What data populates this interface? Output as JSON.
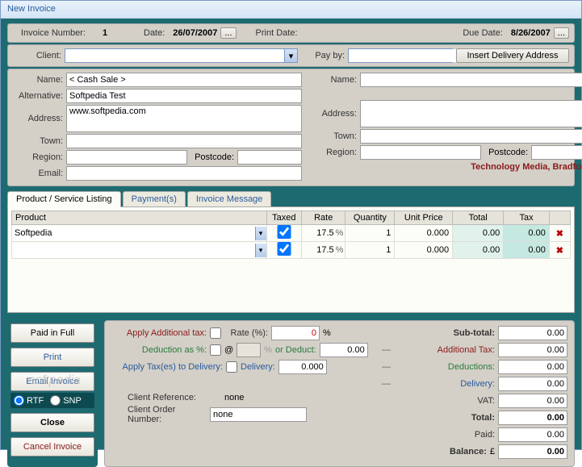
{
  "window": {
    "title": "New Invoice"
  },
  "topbar": {
    "invoice_number_label": "Invoice Number:",
    "invoice_number": "1",
    "date_label": "Date:",
    "date": "26/07/2007",
    "print_date_label": "Print Date:",
    "due_date_label": "Due Date:",
    "due_date": "8/26/2007"
  },
  "clientbar": {
    "client_label": "Client:",
    "payby_label": "Pay by:",
    "insert_addr_label": "Insert Delivery Address"
  },
  "fields": {
    "name_label": "Name:",
    "name": "< Cash Sale >",
    "alt_label": "Alternative:",
    "alt": "Softpedia Test",
    "addr_label": "Address:",
    "addr": "www.softpedia.com",
    "town_label": "Town:",
    "town": "",
    "region_label": "Region:",
    "region": "",
    "postcode_label": "Postcode:",
    "postcode": "",
    "email_label": "Email:",
    "email": "",
    "name2": "",
    "addr2": "",
    "town2": "",
    "region2": "",
    "postcode2": ""
  },
  "company_note": "Technology Media, Bradford.",
  "tabs": {
    "t1": "Product / Service Listing",
    "t2": "Payment(s)",
    "t3": "Invoice Message"
  },
  "gridhead": {
    "product": "Product",
    "taxed": "Taxed",
    "rate": "Rate",
    "qty": "Quantity",
    "unitprice": "Unit Price",
    "total": "Total",
    "tax": "Tax"
  },
  "rows": [
    {
      "product": "Softpedia",
      "taxed": true,
      "rate": "17.5",
      "qty": "1",
      "unitprice": "0.000",
      "total": "0.00",
      "tax": "0.00"
    },
    {
      "product": "",
      "taxed": true,
      "rate": "17.5",
      "qty": "1",
      "unitprice": "0.000",
      "total": "0.00",
      "tax": "0.00"
    }
  ],
  "buttons": {
    "paid": "Paid in Full",
    "print": "Print",
    "email": "Email Invoice",
    "rtf": "RTF",
    "snp": "SNP",
    "close": "Close",
    "cancel": "Cancel  Invoice"
  },
  "tax": {
    "apply_addl": "Apply Additional tax:",
    "rate_pct": "Rate (%):",
    "rate_val": "0",
    "pct": "%",
    "deduct_label": "Deduction as %:",
    "at": "@",
    "or_deduct": "or Deduct:",
    "or_deduct_val": "0.00",
    "apply_taxes": "Apply Tax(es) to Delivery:",
    "delivery": "Delivery:",
    "delivery_val": "0.000",
    "client_ref": "Client Reference:",
    "client_ref_val": "none",
    "client_order": "Client Order Number:",
    "client_order_val": "none"
  },
  "totals": {
    "subtotal_lbl": "Sub-total:",
    "subtotal": "0.00",
    "addl_lbl": "Additional Tax:",
    "addl": "0.00",
    "ded_lbl": "Deductions:",
    "ded": "0.00",
    "del_lbl": "Delivery:",
    "del": "0.00",
    "vat_lbl": "VAT:",
    "vat": "0.00",
    "total_lbl": "Total:",
    "total": "0.00",
    "paid_lbl": "Paid:",
    "paid": "0.00",
    "bal_lbl": "Balance:",
    "curr": "£",
    "bal": "0.00",
    "dash": "—"
  },
  "watermark": "softpedia"
}
